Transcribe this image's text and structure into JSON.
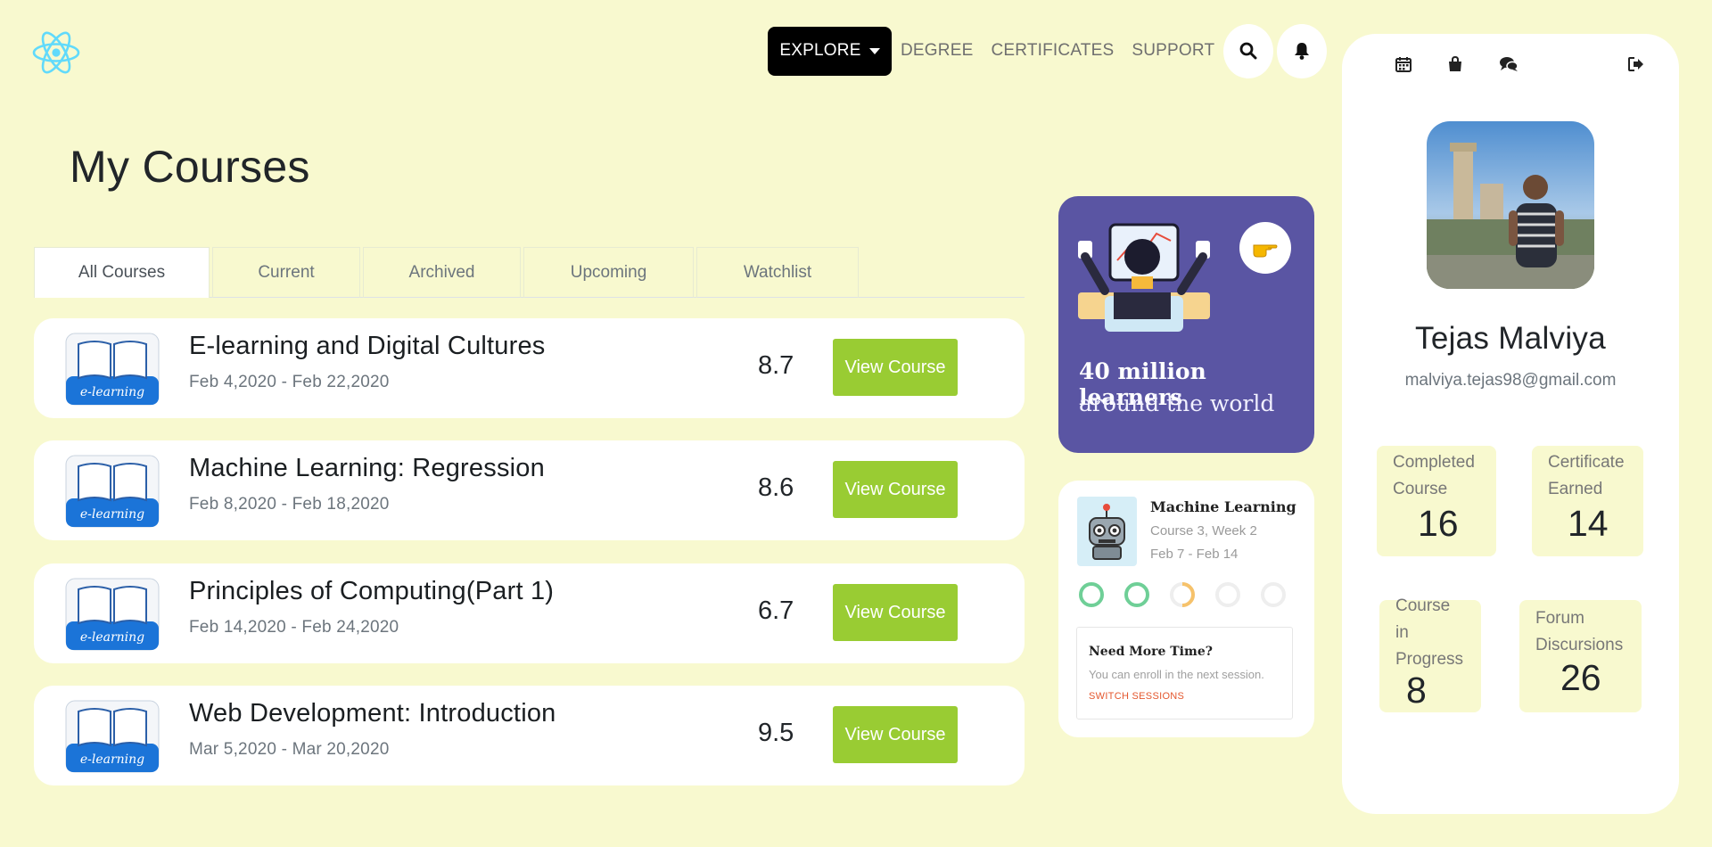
{
  "nav": {
    "explore_label": "EXPLORE",
    "links": [
      "DEGREE",
      "CERTIFICATES",
      "SUPPORT"
    ],
    "logo_icon": "react-logo-icon",
    "search_icon": "search-icon",
    "bell_icon": "bell-icon"
  },
  "page": {
    "title": "My Courses"
  },
  "tabs": [
    {
      "label": "All Courses",
      "active": true
    },
    {
      "label": "Current",
      "active": false
    },
    {
      "label": "Archived",
      "active": false
    },
    {
      "label": "Upcoming",
      "active": false
    },
    {
      "label": "Watchlist",
      "active": false
    }
  ],
  "courses": [
    {
      "title": "E-learning and Digital Cultures",
      "dates": "Feb 4,2020 - Feb 22,2020",
      "rating": "8.7",
      "button": "View Course"
    },
    {
      "title": "Machine Learning: Regression",
      "dates": "Feb 8,2020 - Feb 18,2020",
      "rating": "8.6",
      "button": "View Course"
    },
    {
      "title": "Principles of Computing(Part 1)",
      "dates": "Feb 14,2020 - Feb 24,2020",
      "rating": "6.7",
      "button": "View Course"
    },
    {
      "title": "Web Development: Introduction",
      "dates": "Mar 5,2020 - Mar 20,2020",
      "rating": "9.5",
      "button": "View Course"
    }
  ],
  "course_thumb_text": "e-learning",
  "promo": {
    "line1": "40 million learners",
    "line2": "around the world",
    "hand_icon": "pointing-hand-icon"
  },
  "session": {
    "title": "Machine Learning",
    "subtitle": "Course 3, Week 2",
    "dates": "Feb 7 - Feb 14",
    "progress": [
      "complete",
      "complete",
      "partial",
      "empty",
      "empty"
    ],
    "more_title": "Need More Time?",
    "more_sub": "You can enroll in the next session.",
    "more_link": "SWITCH SESSIONS"
  },
  "profile": {
    "icons": [
      "calendar-icon",
      "shopping-bag-icon",
      "chat-icon",
      "sign-out-icon"
    ],
    "name": "Tejas Malviya",
    "email": "malviya.tejas98@gmail.com",
    "stats": {
      "completed": {
        "label1": "Completed",
        "label2": "Course",
        "value": "16"
      },
      "certificate": {
        "label1": "Certificate",
        "label2": "Earned",
        "value": "14"
      },
      "in_progress": {
        "label1": "Course",
        "label2": "in",
        "label3": "Progress",
        "value": "8"
      },
      "forum": {
        "label1": "Forum",
        "label2": "Discursions",
        "value": "26"
      }
    }
  },
  "colors": {
    "background": "#f8f9cf",
    "accent_green": "#99cc33",
    "promo_purple": "#5a55a3",
    "ring_green": "#6fcf97",
    "ring_orange": "#f6c26b"
  }
}
